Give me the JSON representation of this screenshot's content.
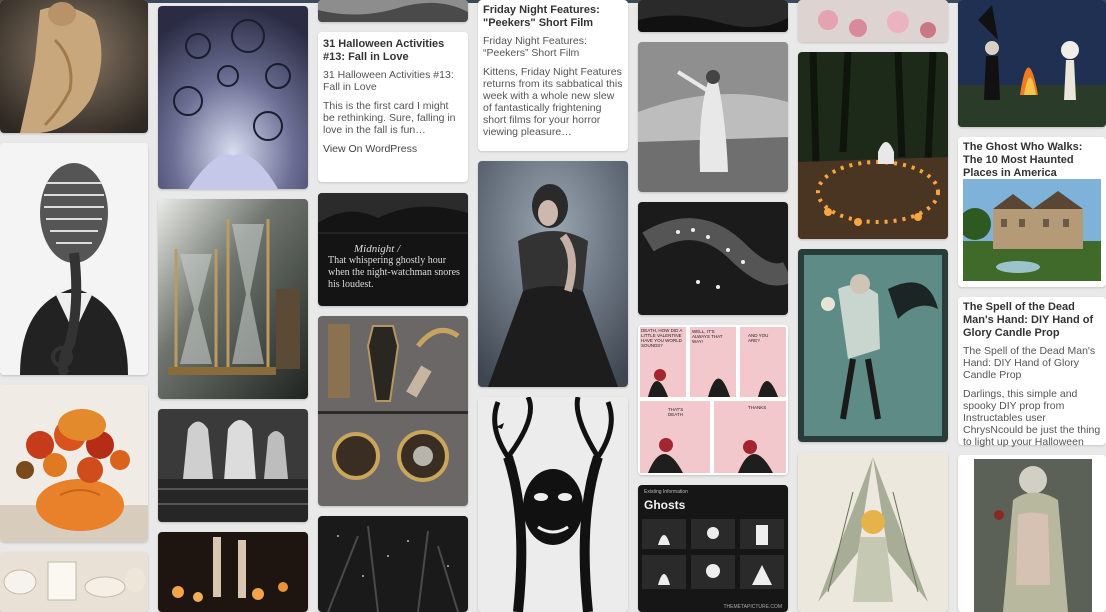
{
  "pins": {
    "card_halloween": {
      "title": "31 Halloween Activities #13: Fall in Love",
      "subtitle": "31 Halloween Activities #13: Fall in Love",
      "description": "This is the first card I might be rethinking.  Sure, falling in love in the fall is fun…",
      "link": "View On WordPress"
    },
    "card_friday": {
      "title": "Friday Night Features: \"Peekers\" Short Film",
      "subtitle": "Friday Night Features: “Peekers” Short Film",
      "description": "Kittens, Friday Night Features returns from its sabbatical this week with a whole new slew of fantastically frightening short films for your horror viewing pleasure…"
    },
    "card_ghost_walks": {
      "title": "The Ghost Who Walks: The 10 Most Haunted Places in America"
    },
    "card_spell": {
      "title": "The Spell of the Dead Man's Hand: DIY Hand of Glory Candle Prop",
      "subtitle": "The Spell of the Dead Man's Hand: DIY Hand of Glory Candle Prop",
      "description": "Darlings, this simple and spooky DIY prop from Instructables user ChrysNcould be just the thing to light up your Halloween"
    },
    "midnight_poster": {
      "heading": "Midnight /",
      "body": "That whispering ghostly hour when the night-watchman snores his loudest."
    },
    "ghosts_infographic": {
      "header": "Existing Information",
      "title": "Ghosts",
      "footer": "THEMETAPICTURE.COM"
    },
    "comic": {
      "panel1": "DEATH, HOW DID A LITTLE VALENTINE HAVE YOU WORLD SOUNDS?",
      "panel2": "WELL, IT'S ALWAYS THAT WAY!",
      "panel3": "AND YOU ARE?",
      "panel4": "THAT'S DEATH",
      "panel5": "THANKS"
    }
  },
  "colors": {
    "background": "#e9e9e9",
    "card": "#ffffff",
    "title_text": "#333333",
    "body_text": "#555555",
    "topbar": "#3a4a5a"
  }
}
